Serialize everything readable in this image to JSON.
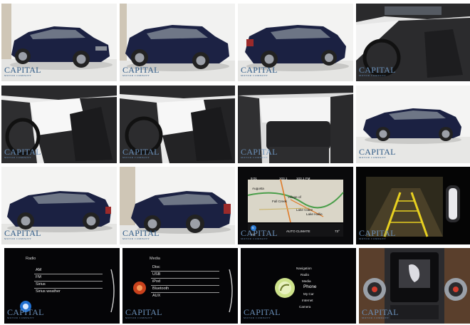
{
  "gallery": {
    "watermark": {
      "name": "CAPITAL",
      "sub": "MOTOR COMPANY"
    },
    "colors": {
      "paint": "#1b2142",
      "watermark": "#2f5a86",
      "studio_floor": "#e9e9e7"
    },
    "tiles": [
      {
        "kind": "exterior-front-left"
      },
      {
        "kind": "exterior-front-left-close"
      },
      {
        "kind": "exterior-rear-left"
      },
      {
        "kind": "interior-dash-sunroof"
      },
      {
        "kind": "interior-driver-door"
      },
      {
        "kind": "interior-driver-seat"
      },
      {
        "kind": "interior-rear-seats"
      },
      {
        "kind": "exterior-side-far"
      },
      {
        "kind": "exterior-side-left"
      },
      {
        "kind": "exterior-rear-quarter"
      },
      {
        "kind": "navigation-map"
      },
      {
        "kind": "backup-camera"
      },
      {
        "kind": "radio-menu"
      },
      {
        "kind": "media-menu"
      },
      {
        "kind": "home-menu"
      },
      {
        "kind": "center-console-controls"
      }
    ]
  },
  "nav_screen": {
    "time": "9:01",
    "radio_freq": "103.1",
    "station": "103.1 FM",
    "places": [
      "Augusta",
      "Fall Creek",
      "Village of",
      "Lake Claire",
      "Lake Hallie"
    ],
    "climate": "AUTO CLIMATE",
    "temp_left": "77°",
    "temp_right": "73°",
    "speed": "5"
  },
  "radio_screen": {
    "title": "Radio",
    "items": [
      "AM",
      "FM",
      "Sirius",
      "Sirius weather"
    ]
  },
  "media_screen": {
    "title": "Media",
    "items": [
      "Disc",
      "USB",
      "iPod",
      "Bluetooth",
      "AUX"
    ]
  },
  "home_screen": {
    "items": [
      "Navigation",
      "Radio",
      "Media",
      "Phone",
      "My Car",
      "Internet",
      "Camera"
    ],
    "selected": "Phone"
  }
}
